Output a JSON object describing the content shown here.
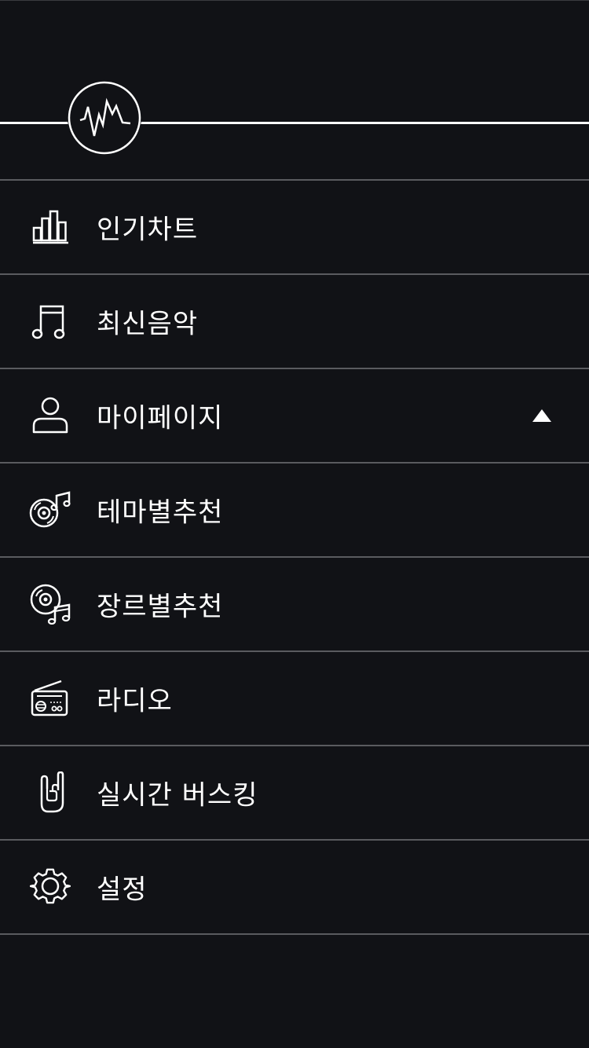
{
  "header": {
    "logo_icon": "waveform-circle-logo"
  },
  "menu": {
    "items": [
      {
        "label": "인기차트",
        "icon": "bar-chart-icon"
      },
      {
        "label": "최신음악",
        "icon": "music-note-icon"
      },
      {
        "label": "마이페이지",
        "icon": "user-icon",
        "expanded": true,
        "caret": "caret-up-icon"
      },
      {
        "label": "테마별추천",
        "icon": "disc-music-icon"
      },
      {
        "label": "장르별추천",
        "icon": "disc-genre-icon"
      },
      {
        "label": "라디오",
        "icon": "radio-icon"
      },
      {
        "label": "실시간 버스킹",
        "icon": "rock-hand-icon"
      },
      {
        "label": "설정",
        "icon": "gear-icon"
      }
    ]
  },
  "colors": {
    "background": "#111216",
    "divider": "#5a5b5f",
    "foreground": "#ffffff"
  }
}
